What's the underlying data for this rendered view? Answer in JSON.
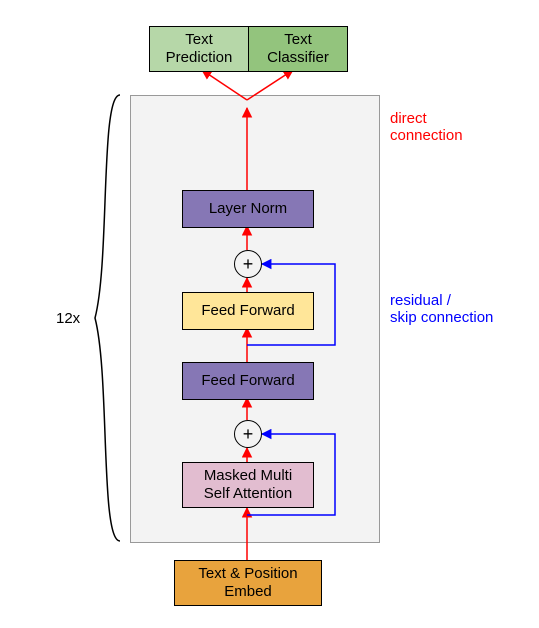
{
  "blocks": {
    "embed": "Text & Position\nEmbed",
    "masked": "Masked Multi\nSelf Attention",
    "ff1": "Feed Forward",
    "ff2": "Feed Forward",
    "layernorm": "Layer Norm",
    "pred": "Text\nPrediction",
    "cls": "Text\nClassifier"
  },
  "labels": {
    "repeat": "12x",
    "direct": "direct\nconnection",
    "residual": "residual /\nskip connection"
  },
  "symbols": {
    "plus": "+"
  }
}
